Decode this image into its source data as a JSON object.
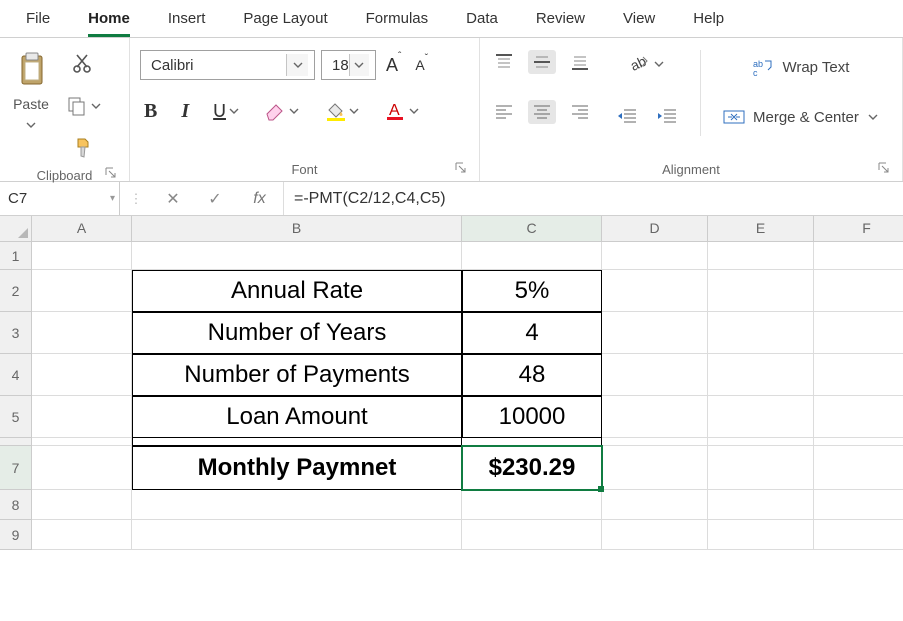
{
  "tabs": [
    "File",
    "Home",
    "Insert",
    "Page Layout",
    "Formulas",
    "Data",
    "Review",
    "View",
    "Help"
  ],
  "active_tab": "Home",
  "ribbon": {
    "clipboard": {
      "paste_label": "Paste",
      "group_label": "Clipboard"
    },
    "font": {
      "group_label": "Font",
      "name": "Calibri",
      "size": "18",
      "bold": "B",
      "italic": "I",
      "underline": "U"
    },
    "alignment": {
      "group_label": "Alignment",
      "wrap": "Wrap Text",
      "merge": "Merge & Center"
    }
  },
  "namebox": "C7",
  "formula": "=-PMT(C2/12,C4,C5)",
  "columns": [
    "A",
    "B",
    "C",
    "D",
    "E",
    "F"
  ],
  "rows": [
    "1",
    "2",
    "3",
    "4",
    "5",
    "7",
    "8",
    "9"
  ],
  "cells": {
    "b2": "Annual Rate",
    "c2": "5%",
    "b3": "Number of Years",
    "c3": "4",
    "b4": "Number of Payments",
    "c4": "48",
    "b5": "Loan Amount",
    "c5": "10000",
    "b7": "Monthly Paymnet",
    "c7": "$230.29"
  },
  "chart_data": {
    "type": "table",
    "rows": [
      {
        "label": "Annual Rate",
        "value": "5%"
      },
      {
        "label": "Number of Years",
        "value": 4
      },
      {
        "label": "Number of Payments",
        "value": 48
      },
      {
        "label": "Loan Amount",
        "value": 10000
      },
      {
        "label": "Monthly Paymnet",
        "value": 230.29,
        "format": "currency",
        "formula": "=-PMT(C2/12,C4,C5)"
      }
    ]
  }
}
